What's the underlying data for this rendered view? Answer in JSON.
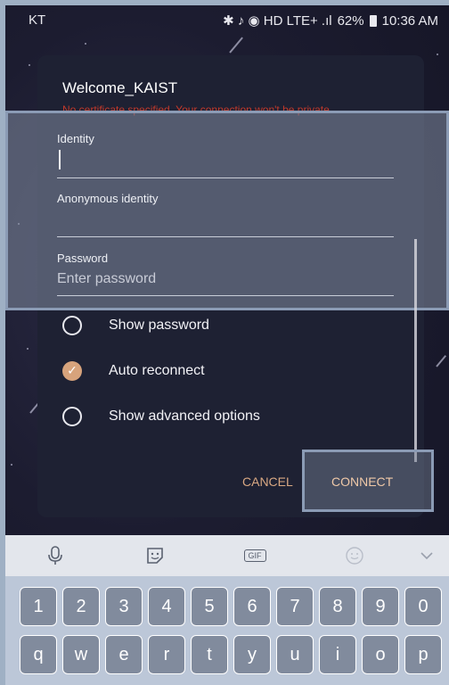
{
  "status_bar": {
    "carrier": "KT",
    "indicators": "✱ ♪ ◉ HD LTE+ .ıl",
    "battery": "62%",
    "time": "10:36 AM"
  },
  "dialog": {
    "title": "Welcome_KAIST",
    "warning": "No certificate specified. Your connection won't be private.",
    "fields": {
      "identity_label": "Identity",
      "identity_value": "",
      "anonymous_label": "Anonymous identity",
      "anonymous_value": "",
      "password_label": "Password",
      "password_placeholder": "Enter password"
    },
    "options": [
      {
        "label": "Show password",
        "checked": false
      },
      {
        "label": "Auto reconnect",
        "checked": true
      },
      {
        "label": "Show advanced options",
        "checked": false
      }
    ],
    "buttons": {
      "cancel": "CANCEL",
      "connect": "CONNECT"
    }
  },
  "keyboard": {
    "toolbar_icons": [
      "microphone-icon",
      "sticker-icon",
      "gif-icon",
      "emoji-icon",
      "chevron-down-icon"
    ],
    "gif_label": "GIF",
    "row_numbers": [
      "1",
      "2",
      "3",
      "4",
      "5",
      "6",
      "7",
      "8",
      "9",
      "0"
    ],
    "row_letters": [
      "q",
      "w",
      "e",
      "r",
      "t",
      "y",
      "u",
      "i",
      "o",
      "p"
    ]
  },
  "colors": {
    "accent": "#d7a37c",
    "warning": "#c0392b",
    "dialog_bg": "#1e2133"
  }
}
